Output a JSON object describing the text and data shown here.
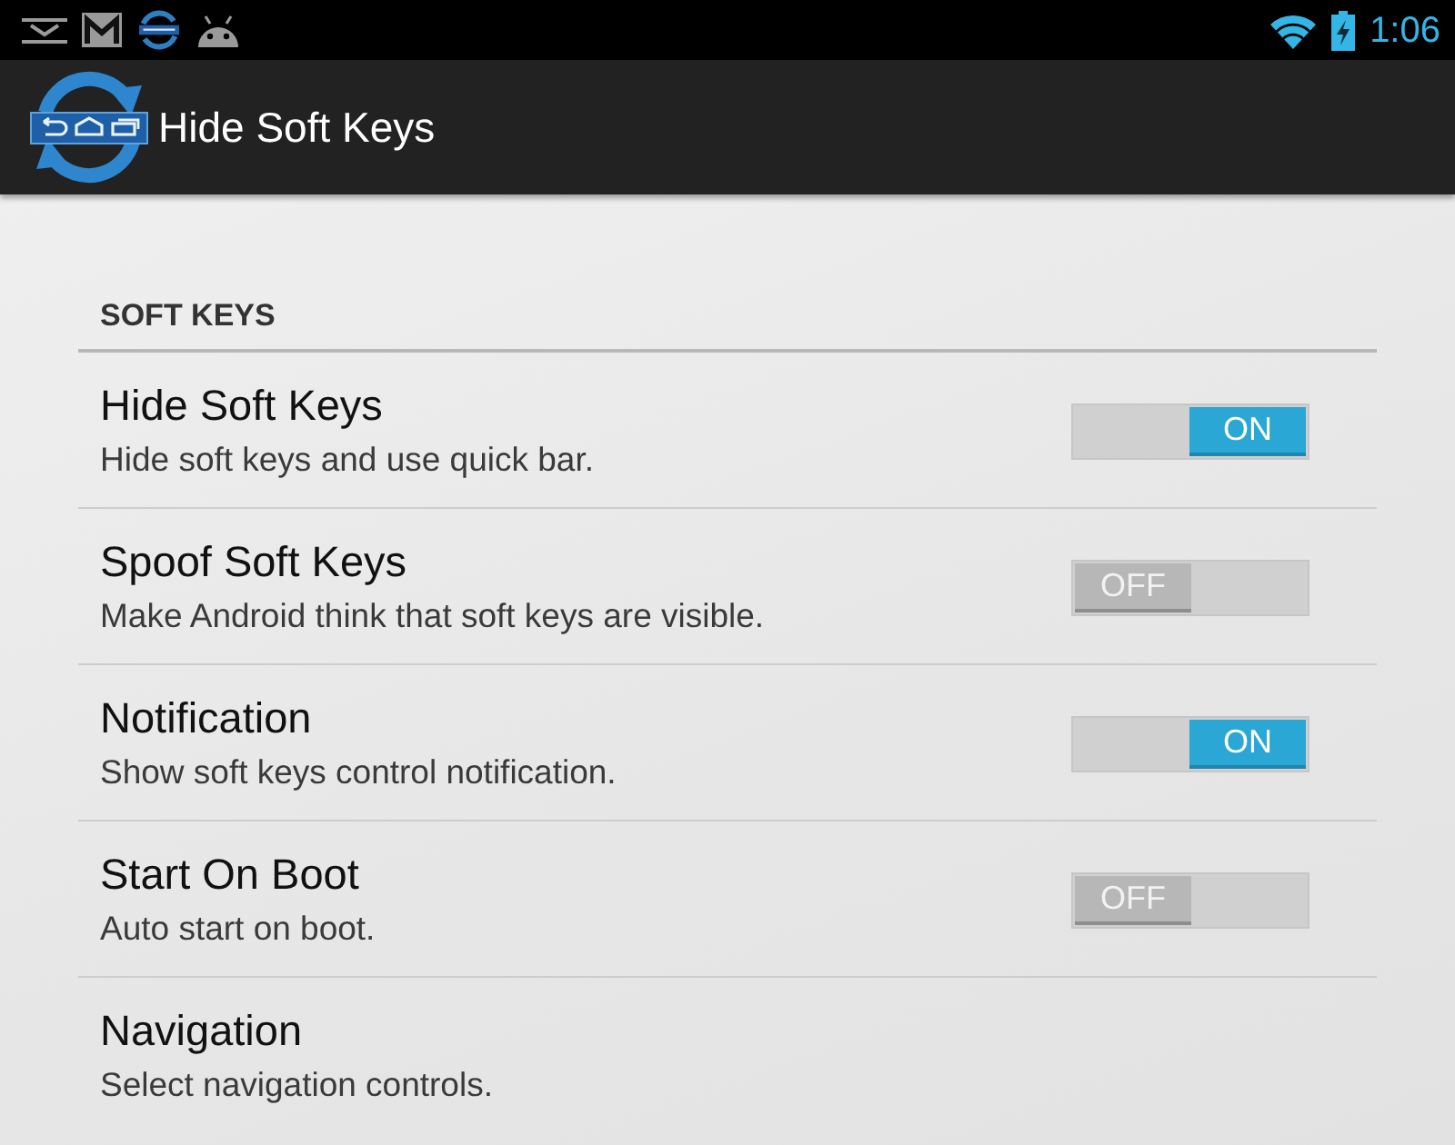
{
  "status_bar": {
    "time": "1:06"
  },
  "action_bar": {
    "title": "Hide Soft Keys"
  },
  "section": {
    "title": "SOFT KEYS"
  },
  "settings": [
    {
      "kind": "toggle",
      "title": "Hide Soft Keys",
      "summary": "Hide soft keys and use quick bar.",
      "on": true,
      "switch_text": "ON"
    },
    {
      "kind": "toggle",
      "title": "Spoof Soft Keys",
      "summary": "Make Android think that soft keys are visible.",
      "on": false,
      "switch_text": "OFF"
    },
    {
      "kind": "toggle",
      "title": "Notification",
      "summary": "Show soft keys control notification.",
      "on": true,
      "switch_text": "ON"
    },
    {
      "kind": "toggle",
      "title": "Start On Boot",
      "summary": "Auto start on boot.",
      "on": false,
      "switch_text": "OFF"
    },
    {
      "kind": "link",
      "title": "Navigation",
      "summary": "Select navigation controls."
    }
  ]
}
